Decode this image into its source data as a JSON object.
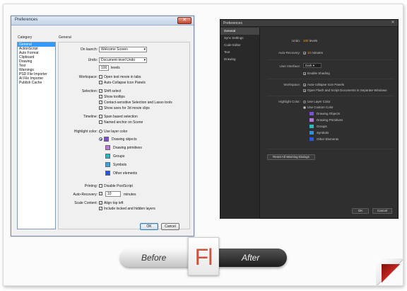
{
  "before": {
    "window_title": "Preferences",
    "category_label": "Category",
    "categories": [
      "General",
      "ActionScript",
      "Auto Format",
      "Clipboard",
      "Drawing",
      "Text",
      "Warnings",
      "PSD File Importer",
      "AI File Importer",
      "Publish Cache"
    ],
    "selected_category": "General",
    "section_title": "General",
    "on_launch": {
      "label": "On launch:",
      "value": "Welcome Screen"
    },
    "undo": {
      "label": "Undo:",
      "value": "Document-level Undo",
      "levels": "100",
      "levels_label": "levels"
    },
    "workspace": {
      "label": "Workspace:",
      "options": [
        "Open test movie in tabs",
        "Auto-Collapse Icon Panels"
      ]
    },
    "selection": {
      "label": "Selection:",
      "options": [
        "Shift select",
        "Show tooltips",
        "Contact-sensitive Selection and Lasso tools",
        "Show axes for 3d movie clips"
      ]
    },
    "timeline": {
      "label": "Timeline:",
      "options": [
        "Span based selection",
        "Named anchor on Scene"
      ]
    },
    "highlight": {
      "label": "Highlight color:",
      "use_layer": "Use layer color",
      "items": [
        "Drawing objects",
        "Drawing primitives",
        "Groups",
        "Symbols",
        "Other elements"
      ],
      "colors": [
        "#7a4fc8",
        "#b779d6",
        "#2fb4c4",
        "#3aa2e0",
        "#2855d8"
      ]
    },
    "printing": {
      "label": "Printing:",
      "option": "Disable PostScript"
    },
    "auto_recovery": {
      "label": "Auto-Recovery:",
      "value": "10",
      "unit": "minutes"
    },
    "scale_content": {
      "label": "Scale Content:",
      "options": [
        "Align top left",
        "Include locked and hidden layers"
      ]
    },
    "buttons": {
      "ok": "OK",
      "cancel": "Cancel"
    }
  },
  "after": {
    "window_title": "Preferences",
    "categories": [
      "General",
      "Sync Settings",
      "Code Editor",
      "Text",
      "Drawing"
    ],
    "selected_category": "General",
    "undo": {
      "label": "Undo:",
      "value": "100",
      "unit": "levels"
    },
    "auto_recovery": {
      "label": "Auto-Recovery:",
      "value": "10",
      "unit": "minutes"
    },
    "user_interface": {
      "label": "User Interface:",
      "value": "Dark",
      "shading": "Enable Shading"
    },
    "workspace": {
      "label": "Workspace:",
      "options": [
        "Auto-collapse Icon Panels",
        "Open Flash and Script Documents in Separate Windows"
      ]
    },
    "highlight": {
      "label": "Highlight Color:",
      "use_layer": "Use Layer Color",
      "use_custom": "Use Custom Color",
      "items": [
        "Drawing Objects",
        "Drawing Primitives",
        "Groups",
        "Symbols",
        "Other Elements"
      ],
      "colors": [
        "#7b50d8",
        "#b676e0",
        "#2fb8bf",
        "#2f8fd8",
        "#2a56e0"
      ]
    },
    "reset_button": "Reset All Warning Dialogs",
    "buttons": {
      "ok": "OK",
      "cancel": "Cancel"
    }
  },
  "banner": {
    "before": "Before",
    "after": "After",
    "logo": "Fl"
  }
}
